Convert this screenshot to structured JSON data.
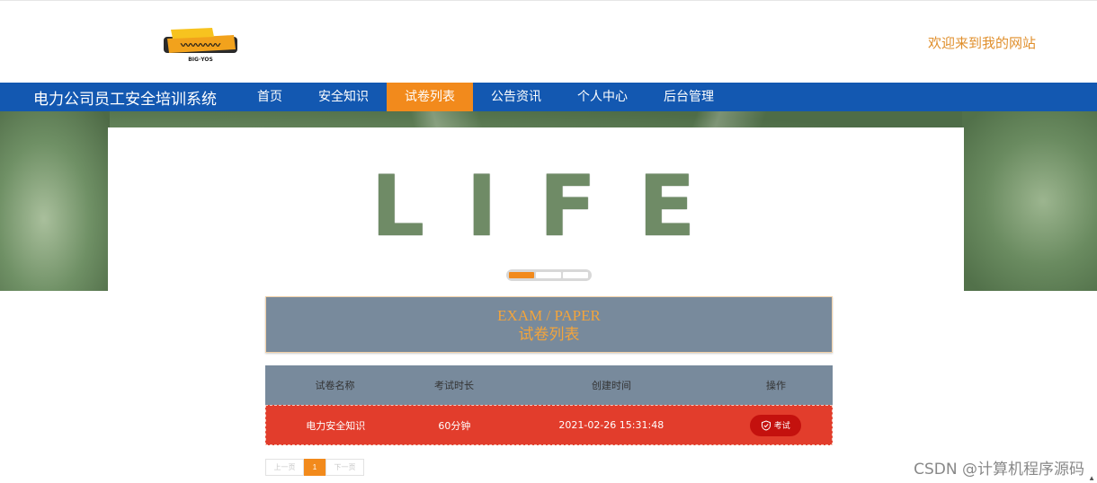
{
  "header": {
    "logo_alt": "site logo",
    "welcome": "欢迎来到我的网站"
  },
  "nav": {
    "brand": "电力公司员工安全培训系统",
    "items": [
      {
        "label": "首页",
        "active": false
      },
      {
        "label": "安全知识",
        "active": false
      },
      {
        "label": "试卷列表",
        "active": true
      },
      {
        "label": "公告资讯",
        "active": false
      },
      {
        "label": "个人中心",
        "active": false
      },
      {
        "label": "后台管理",
        "active": false
      }
    ]
  },
  "banner": {
    "word": "LIFE",
    "slides_total": 3,
    "slide_active": 1
  },
  "section": {
    "title_en": "EXAM / PAPER",
    "title_cn": "试卷列表"
  },
  "table": {
    "headers": [
      "试卷名称",
      "考试时长",
      "创建时间",
      "操作"
    ],
    "rows": [
      {
        "name": "电力安全知识",
        "duration": "60分钟",
        "created": "2021-02-26 15:31:48",
        "action": "考试"
      }
    ]
  },
  "pager": {
    "prev": "上一页",
    "current": "1",
    "next": "下一页"
  },
  "watermark": "CSDN @计算机程序源码",
  "colors": {
    "nav_bg": "#1358b1",
    "accent": "#f28a1c",
    "row_bg": "#e23d2c",
    "header_bg": "#788a9c"
  }
}
